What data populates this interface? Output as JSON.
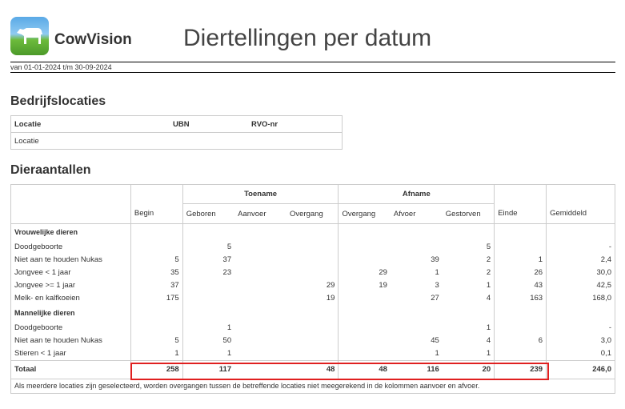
{
  "header": {
    "brand": "CowVision",
    "title": "Diertellingen per datum",
    "period": "van 01-01-2024 t/m 30-09-2024"
  },
  "locations": {
    "heading": "Bedrijfslocaties",
    "columns": [
      "Locatie",
      "UBN",
      "RVO-nr"
    ],
    "row": "Locatie"
  },
  "animals": {
    "heading": "Dieraantallen",
    "group_toename": "Toename",
    "group_afname": "Afname",
    "columns": [
      "Begin",
      "Geboren",
      "Aanvoer",
      "Overgang",
      "Overgang",
      "Afvoer",
      "Gestorven",
      "Einde",
      "Gemiddeld"
    ],
    "female": {
      "label": "Vrouwelijke dieren",
      "rows": [
        [
          "Doodgeboorte",
          "",
          "5",
          "",
          "",
          "",
          "",
          "5",
          "",
          "-"
        ],
        [
          "Niet aan te houden Nukas",
          "5",
          "37",
          "",
          "",
          "",
          "39",
          "2",
          "1",
          "2,4"
        ],
        [
          "Jongvee < 1 jaar",
          "35",
          "23",
          "",
          "",
          "29",
          "1",
          "2",
          "26",
          "30,0"
        ],
        [
          "Jongvee >= 1 jaar",
          "37",
          "",
          "",
          "29",
          "19",
          "3",
          "1",
          "43",
          "42,5"
        ],
        [
          "Melk- en kalfkoeien",
          "175",
          "",
          "",
          "19",
          "",
          "27",
          "4",
          "163",
          "168,0"
        ]
      ]
    },
    "male": {
      "label": "Mannelijke dieren",
      "rows": [
        [
          "Doodgeboorte",
          "",
          "1",
          "",
          "",
          "",
          "",
          "1",
          "",
          "-"
        ],
        [
          "Niet aan te houden Nukas",
          "5",
          "50",
          "",
          "",
          "",
          "45",
          "4",
          "6",
          "3,0"
        ],
        [
          "Stieren < 1 jaar",
          "1",
          "1",
          "",
          "",
          "",
          "1",
          "1",
          "",
          "0,1"
        ]
      ]
    },
    "total": [
      "Totaal",
      "258",
      "117",
      "",
      "48",
      "48",
      "116",
      "20",
      "239",
      "246,0"
    ],
    "footnote": "Als meerdere locaties zijn geselecteerd, worden overgangen tussen de betreffende locaties niet meegerekend in de kolommen aanvoer en afvoer."
  },
  "highlight_color": "#e02020"
}
